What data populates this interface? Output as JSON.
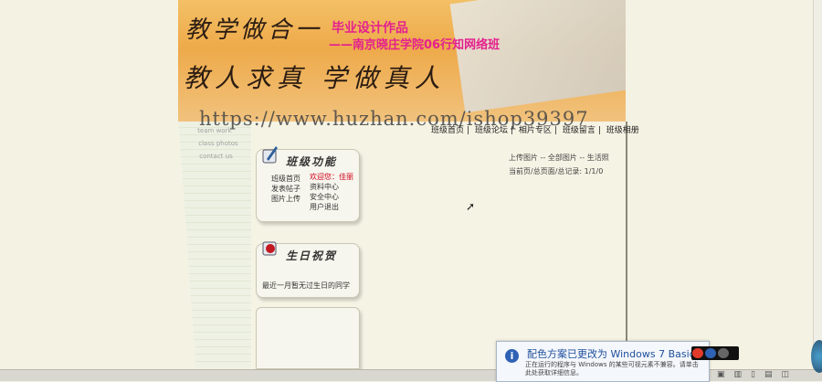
{
  "banner": {
    "calligraphy_line1": "教学做合一",
    "calligraphy_line2": "教人求真 学做真人",
    "subtitle1": "毕业设计作品",
    "subtitle2": "——南京晓庄学院06行知网络班"
  },
  "watermark": "https://www.huzhan.com/ishop39397",
  "topnav": {
    "items": [
      "班级首页",
      "|",
      "班级论坛",
      "|",
      "相片专区",
      "|",
      "班级留言",
      "|",
      "班级相册"
    ]
  },
  "side_paper": {
    "lines": [
      "team work",
      "class photos",
      "contact us"
    ]
  },
  "right_info": {
    "line1": "上传图片 -- 全部图片 -- 生活照",
    "line2": "当前页/总页面/总记录: 1/1/0"
  },
  "box1": {
    "title": "班级功能",
    "left_links": [
      "班级首页",
      "发表帖子",
      "图片上传"
    ],
    "welcome": "欢迎您：佳丽",
    "right_links": [
      "资料中心",
      "安全中心",
      "用户退出"
    ]
  },
  "box2": {
    "title": "生日祝贺",
    "message": "最近一月暂无过生日的同学"
  },
  "notification": {
    "title": "配色方案已更改为 Windows 7 Basic",
    "body": "正在运行的程序与 Windows 的某些可视元素不兼容。请单击此处获取详细信息。"
  },
  "icons": {
    "info": "info-icon",
    "cursor": "mouse-cursor-icon"
  }
}
